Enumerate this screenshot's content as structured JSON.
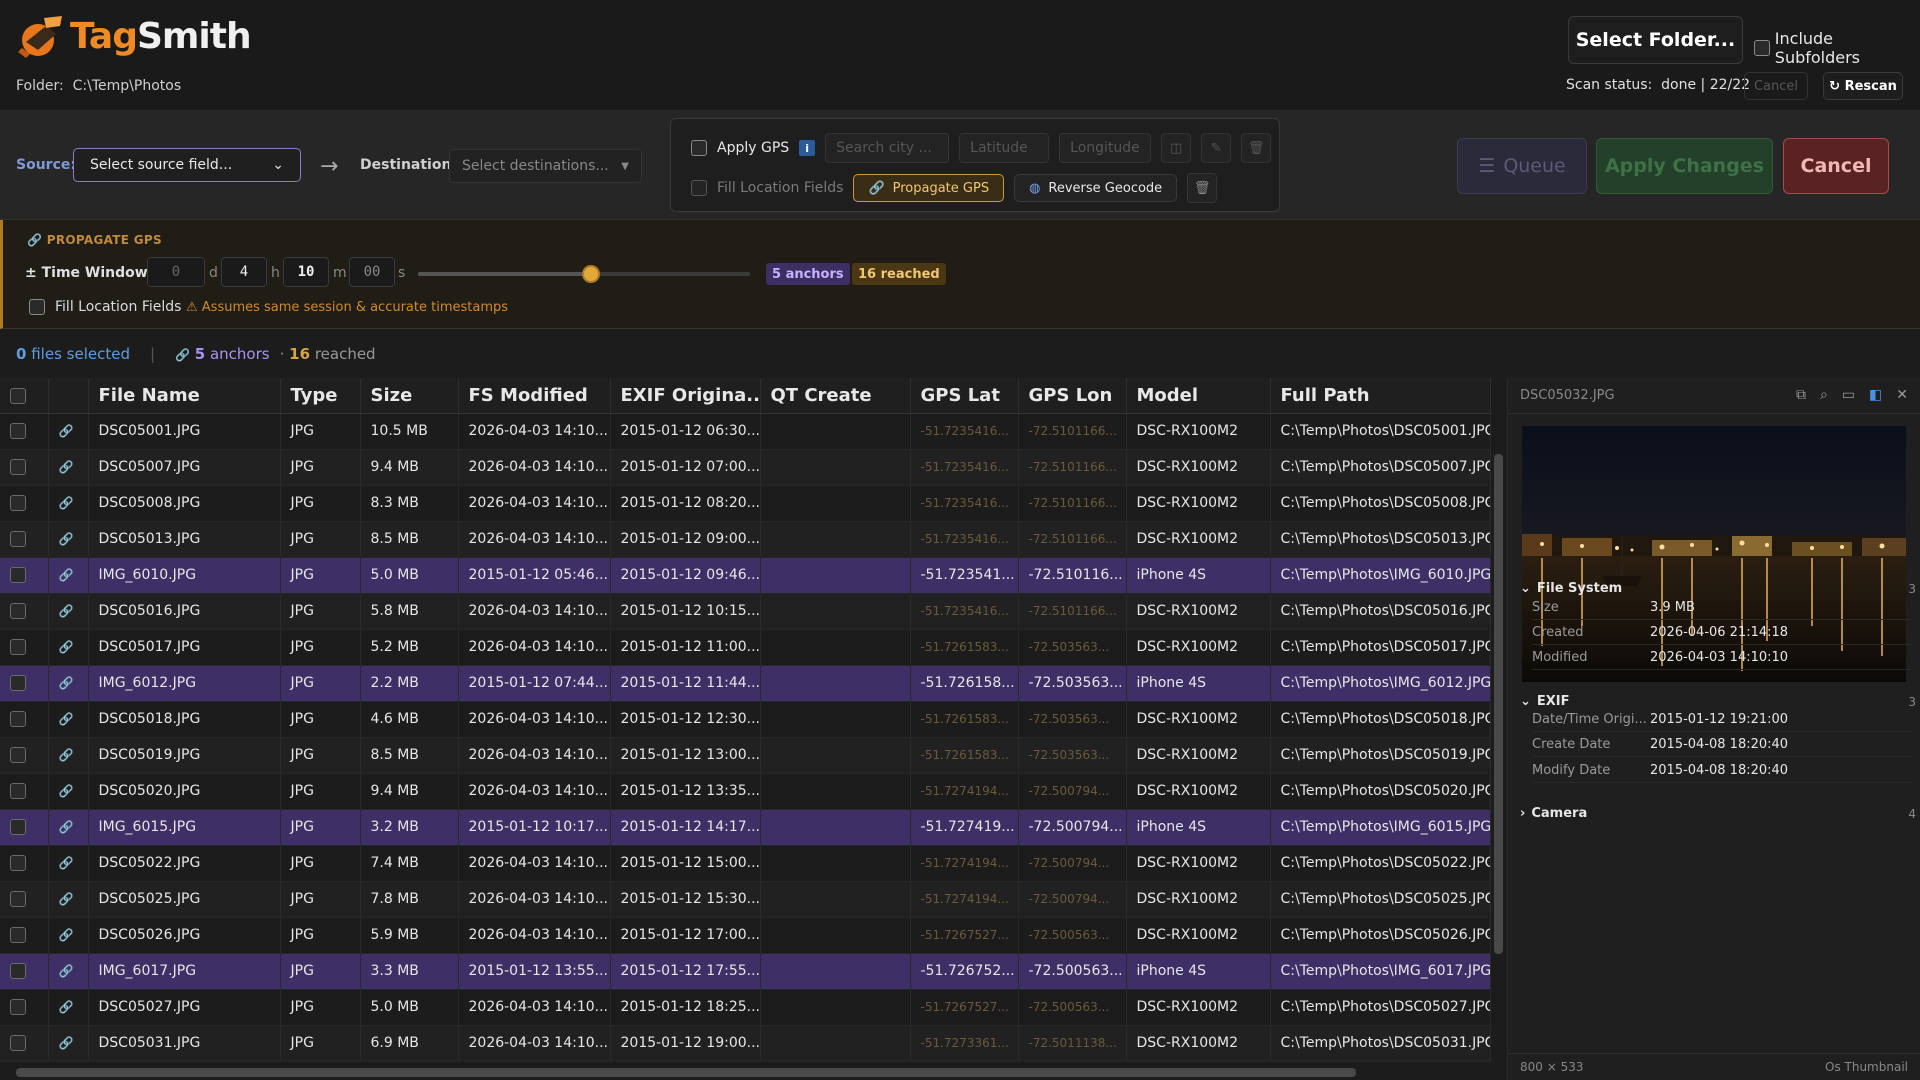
{
  "app": {
    "logo_a": "Tag",
    "logo_b": "Smith",
    "folder_label": "Folder:",
    "folder_path": "C:\\Temp\\Photos"
  },
  "header": {
    "select_folder": "Select Folder...",
    "include_subfolders": "Include Subfolders",
    "scan_status_label": "Scan status:",
    "scan_status_value": "done | 22/22",
    "cancel": "Cancel",
    "rescan": "Rescan"
  },
  "toolbar": {
    "source_label": "Source:",
    "source_value": "Select source field...",
    "dest_label": "Destination:",
    "dest_value": "Select destinations...",
    "apply_gps": "Apply GPS",
    "search_city_placeholder": "Search city ...",
    "latitude_placeholder": "Latitude",
    "longitude_placeholder": "Longitude",
    "fill_location": "Fill Location Fields",
    "propagate_gps": "Propagate GPS",
    "reverse_geocode": "Reverse Geocode",
    "queue": "Queue",
    "apply_changes": "Apply Changes",
    "cancel": "Cancel"
  },
  "propagate": {
    "title": "PROPAGATE GPS",
    "time_window_label": "± Time Window",
    "days": "0",
    "days_unit": "d",
    "hours": "4",
    "hours_unit": "h",
    "minutes": "10",
    "minutes_unit": "m",
    "seconds": "00",
    "seconds_unit": "s",
    "slider_fraction": 0.52,
    "anchors": "5 anchors",
    "reached": "16 reached",
    "fill_location": "Fill Location Fields",
    "warning": "⚠ Assumes same session & accurate timestamps"
  },
  "selection": {
    "count": "0",
    "files_selected": "files selected",
    "sep": "|",
    "anchors_num": "5",
    "anchors_word": "anchors",
    "reached_num": "16",
    "reached_word": "reached"
  },
  "table": {
    "columns": [
      "File Name",
      "Type",
      "Size",
      "FS Modified",
      "EXIF Origina...",
      "QT Create",
      "GPS Lat",
      "GPS Lon",
      "Model",
      "Full Path"
    ],
    "rows": [
      {
        "name": "DSC05001.JPG",
        "type": "JPG",
        "size": "10.5 MB",
        "fs": "2026-04-03 14:10...",
        "exif": "2015-01-12 06:30...",
        "qt": "",
        "lat": "-51.7235416...",
        "lon": "-72.5101166...",
        "model": "DSC-RX100M2",
        "path": "C:\\Temp\\Photos\\DSC05001.JPG",
        "anchor": false
      },
      {
        "name": "DSC05007.JPG",
        "type": "JPG",
        "size": "9.4 MB",
        "fs": "2026-04-03 14:10...",
        "exif": "2015-01-12 07:00...",
        "qt": "",
        "lat": "-51.7235416...",
        "lon": "-72.5101166...",
        "model": "DSC-RX100M2",
        "path": "C:\\Temp\\Photos\\DSC05007.JPG",
        "anchor": false
      },
      {
        "name": "DSC05008.JPG",
        "type": "JPG",
        "size": "8.3 MB",
        "fs": "2026-04-03 14:10...",
        "exif": "2015-01-12 08:20...",
        "qt": "",
        "lat": "-51.7235416...",
        "lon": "-72.5101166...",
        "model": "DSC-RX100M2",
        "path": "C:\\Temp\\Photos\\DSC05008.JPG",
        "anchor": false
      },
      {
        "name": "DSC05013.JPG",
        "type": "JPG",
        "size": "8.5 MB",
        "fs": "2026-04-03 14:10...",
        "exif": "2015-01-12 09:00...",
        "qt": "",
        "lat": "-51.7235416...",
        "lon": "-72.5101166...",
        "model": "DSC-RX100M2",
        "path": "C:\\Temp\\Photos\\DSC05013.JPG",
        "anchor": false
      },
      {
        "name": "IMG_6010.JPG",
        "type": "JPG",
        "size": "5.0 MB",
        "fs": "2015-01-12 05:46...",
        "exif": "2015-01-12 09:46...",
        "qt": "",
        "lat": "-51.723541...",
        "lon": "-72.510116...",
        "model": "iPhone 4S",
        "path": "C:\\Temp\\Photos\\IMG_6010.JPG",
        "anchor": true
      },
      {
        "name": "DSC05016.JPG",
        "type": "JPG",
        "size": "5.8 MB",
        "fs": "2026-04-03 14:10...",
        "exif": "2015-01-12 10:15...",
        "qt": "",
        "lat": "-51.7235416...",
        "lon": "-72.5101166...",
        "model": "DSC-RX100M2",
        "path": "C:\\Temp\\Photos\\DSC05016.JPG",
        "anchor": false
      },
      {
        "name": "DSC05017.JPG",
        "type": "JPG",
        "size": "5.2 MB",
        "fs": "2026-04-03 14:10...",
        "exif": "2015-01-12 11:00...",
        "qt": "",
        "lat": "-51.7261583...",
        "lon": "-72.503563...",
        "model": "DSC-RX100M2",
        "path": "C:\\Temp\\Photos\\DSC05017.JPG",
        "anchor": false
      },
      {
        "name": "IMG_6012.JPG",
        "type": "JPG",
        "size": "2.2 MB",
        "fs": "2015-01-12 07:44...",
        "exif": "2015-01-12 11:44...",
        "qt": "",
        "lat": "-51.726158...",
        "lon": "-72.503563...",
        "model": "iPhone 4S",
        "path": "C:\\Temp\\Photos\\IMG_6012.JPG",
        "anchor": true
      },
      {
        "name": "DSC05018.JPG",
        "type": "JPG",
        "size": "4.6 MB",
        "fs": "2026-04-03 14:10...",
        "exif": "2015-01-12 12:30...",
        "qt": "",
        "lat": "-51.7261583...",
        "lon": "-72.503563...",
        "model": "DSC-RX100M2",
        "path": "C:\\Temp\\Photos\\DSC05018.JPG",
        "anchor": false
      },
      {
        "name": "DSC05019.JPG",
        "type": "JPG",
        "size": "8.5 MB",
        "fs": "2026-04-03 14:10...",
        "exif": "2015-01-12 13:00...",
        "qt": "",
        "lat": "-51.7261583...",
        "lon": "-72.503563...",
        "model": "DSC-RX100M2",
        "path": "C:\\Temp\\Photos\\DSC05019.JPG",
        "anchor": false
      },
      {
        "name": "DSC05020.JPG",
        "type": "JPG",
        "size": "9.4 MB",
        "fs": "2026-04-03 14:10...",
        "exif": "2015-01-12 13:35...",
        "qt": "",
        "lat": "-51.7274194...",
        "lon": "-72.500794...",
        "model": "DSC-RX100M2",
        "path": "C:\\Temp\\Photos\\DSC05020.JPG",
        "anchor": false
      },
      {
        "name": "IMG_6015.JPG",
        "type": "JPG",
        "size": "3.2 MB",
        "fs": "2015-01-12 10:17...",
        "exif": "2015-01-12 14:17...",
        "qt": "",
        "lat": "-51.727419...",
        "lon": "-72.500794...",
        "model": "iPhone 4S",
        "path": "C:\\Temp\\Photos\\IMG_6015.JPG",
        "anchor": true
      },
      {
        "name": "DSC05022.JPG",
        "type": "JPG",
        "size": "7.4 MB",
        "fs": "2026-04-03 14:10...",
        "exif": "2015-01-12 15:00...",
        "qt": "",
        "lat": "-51.7274194...",
        "lon": "-72.500794...",
        "model": "DSC-RX100M2",
        "path": "C:\\Temp\\Photos\\DSC05022.JPG",
        "anchor": false
      },
      {
        "name": "DSC05025.JPG",
        "type": "JPG",
        "size": "7.8 MB",
        "fs": "2026-04-03 14:10...",
        "exif": "2015-01-12 15:30...",
        "qt": "",
        "lat": "-51.7274194...",
        "lon": "-72.500794...",
        "model": "DSC-RX100M2",
        "path": "C:\\Temp\\Photos\\DSC05025.JPG",
        "anchor": false
      },
      {
        "name": "DSC05026.JPG",
        "type": "JPG",
        "size": "5.9 MB",
        "fs": "2026-04-03 14:10...",
        "exif": "2015-01-12 17:00...",
        "qt": "",
        "lat": "-51.7267527...",
        "lon": "-72.500563...",
        "model": "DSC-RX100M2",
        "path": "C:\\Temp\\Photos\\DSC05026.JPG",
        "anchor": false
      },
      {
        "name": "IMG_6017.JPG",
        "type": "JPG",
        "size": "3.3 MB",
        "fs": "2015-01-12 13:55...",
        "exif": "2015-01-12 17:55...",
        "qt": "",
        "lat": "-51.726752...",
        "lon": "-72.500563...",
        "model": "iPhone 4S",
        "path": "C:\\Temp\\Photos\\IMG_6017.JPG",
        "anchor": true
      },
      {
        "name": "DSC05027.JPG",
        "type": "JPG",
        "size": "5.0 MB",
        "fs": "2026-04-03 14:10...",
        "exif": "2015-01-12 18:25...",
        "qt": "",
        "lat": "-51.7267527...",
        "lon": "-72.500563...",
        "model": "DSC-RX100M2",
        "path": "C:\\Temp\\Photos\\DSC05027.JPG",
        "anchor": false
      },
      {
        "name": "DSC05031.JPG",
        "type": "JPG",
        "size": "6.9 MB",
        "fs": "2026-04-03 14:10...",
        "exif": "2015-01-12 19:00...",
        "qt": "",
        "lat": "-51.7273361...",
        "lon": "-72.5011138...",
        "model": "DSC-RX100M2",
        "path": "C:\\Temp\\Photos\\DSC05031.JPG",
        "anchor": false
      }
    ]
  },
  "preview": {
    "filename": "DSC05032.JPG",
    "file_system": {
      "title": "File System",
      "count": "3",
      "rows": [
        [
          "Size",
          "3.9 MB"
        ],
        [
          "Created",
          "2026-04-06 21:14:18"
        ],
        [
          "Modified",
          "2026-04-03 14:10:10"
        ]
      ]
    },
    "exif": {
      "title": "EXIF",
      "count": "3",
      "rows": [
        [
          "Date/Time Origi...",
          "2015-01-12 19:21:00"
        ],
        [
          "Create Date",
          "2015-04-08 18:20:40"
        ],
        [
          "Modify Date",
          "2015-04-08 18:20:40"
        ]
      ]
    },
    "camera": {
      "title": "Camera",
      "count": "4"
    },
    "dimensions": "800 × 533",
    "thumb_source": "Os Thumbnail"
  },
  "colors": {
    "accent_purple": "#3e2f66",
    "accent_orange": "#f08a24",
    "danger": "#5a2323"
  }
}
